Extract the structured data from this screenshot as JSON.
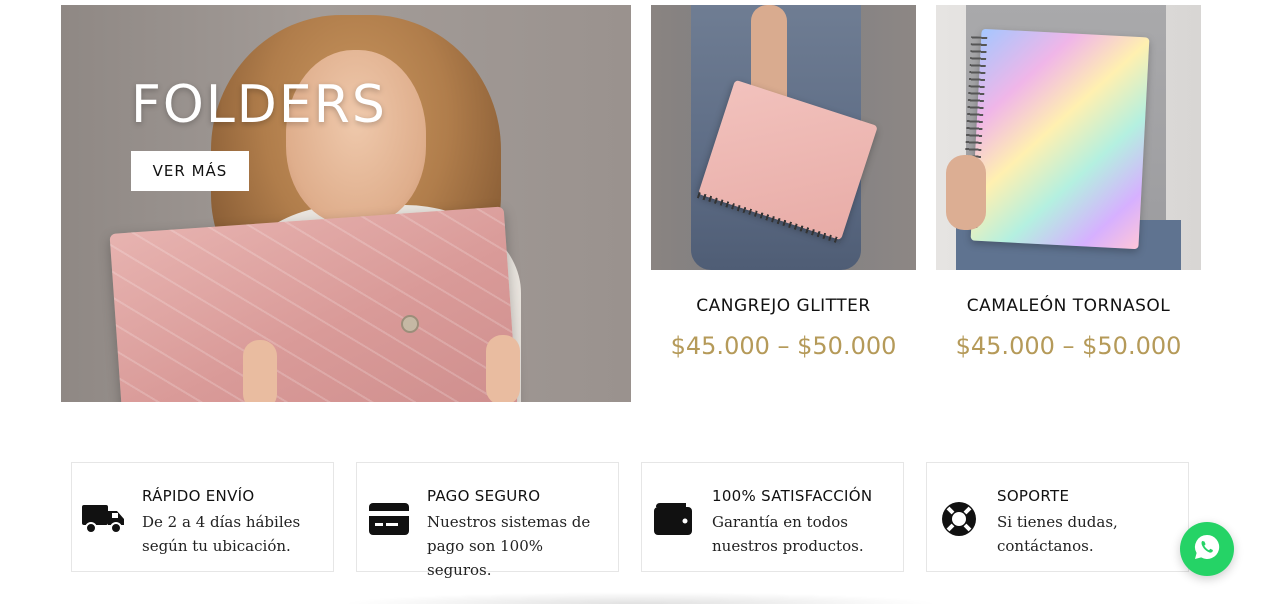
{
  "hero": {
    "title": "FOLDERS",
    "button_label": "VER MÁS"
  },
  "products": [
    {
      "name": "CANGREJO GLITTER",
      "price": "$45.000 – $50.000"
    },
    {
      "name": "CAMALEÓN TORNASOL",
      "price": "$45.000 – $50.000"
    }
  ],
  "features": [
    {
      "icon": "truck-icon",
      "title": "RÁPIDO ENVÍO",
      "text": "De 2 a 4 días hábiles según tu ubicación."
    },
    {
      "icon": "credit-card-icon",
      "title": "PAGO SEGURO",
      "text": "Nuestros sistemas de pago son 100% seguros."
    },
    {
      "icon": "wallet-icon",
      "title": "100% SATISFACCIÓN",
      "text": "Garantía en todos nuestros productos."
    },
    {
      "icon": "lifebuoy-icon",
      "title": "SOPORTE",
      "text": "Si tienes dudas, contáctanos."
    }
  ],
  "whatsapp": {
    "icon": "whatsapp-icon"
  },
  "colors": {
    "price": "#b59a59",
    "whatsapp": "#25d366",
    "feature_border": "#e6e6e6"
  }
}
